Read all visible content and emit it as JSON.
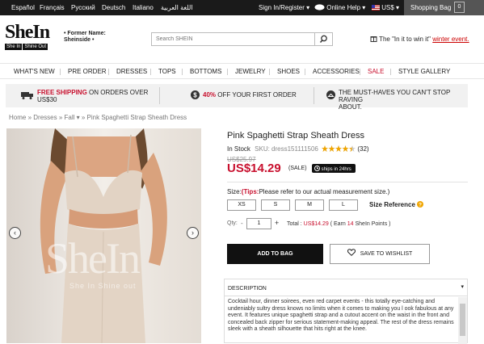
{
  "topbar": {
    "languages": [
      "Español",
      "Français",
      "Русский",
      "Deutsch",
      "Italiano",
      "اللغة العربية"
    ],
    "signin": "Sign In/Register",
    "online_help": "Online Help",
    "currency": "US$",
    "bag": "Shopping Bag",
    "bag_count": "0"
  },
  "header": {
    "logo": "SheIn",
    "logo_tag1": "She In",
    "logo_tag2": "Shine Out",
    "former_line1": "• Former Name:",
    "former_line2": "Sheinside •",
    "search_placeholder": "Search SHEIN",
    "promo_text": "The \"In it to win it\"",
    "promo_link": "winter event."
  },
  "nav": [
    "WHAT'S NEW",
    "PRE ORDER",
    "DRESSES",
    "TOPS",
    "BOTTOMS",
    "JEWELRY",
    "SHOES",
    "ACCESSORIES",
    "SALE",
    "STYLE GALLERY"
  ],
  "infobar": {
    "shipping_strong": "FREE SHIPPING",
    "shipping_rest": "ON ORDERS OVER",
    "shipping_amount": "US$30",
    "discount_pct": "40%",
    "discount_rest": "OFF YOUR FIRST ORDER",
    "musthave_line1": "THE MUST-HAVES YOU CAN'T STOP RAVING",
    "musthave_line2": "ABOUT."
  },
  "breadcrumb": {
    "home": "Home »",
    "dresses": "Dresses »",
    "fall": "Fall",
    "current": "» Pink Spaghetti Strap Sheath Dress"
  },
  "product": {
    "title": "Pink Spaghetti Strap Sheath Dress",
    "stock": "In Stock",
    "sku": "SKU: dress151111506",
    "rating": 4.5,
    "reviews": "(32)",
    "old_price": "US$25.97",
    "price": "US$14.29",
    "sale_label": "(SALE)",
    "ships": "ships in 24hrs",
    "size_label": "Size:",
    "size_tips": "(Tips:",
    "size_tips_rest": "Please refer to our actual measurement size.)",
    "sizes": [
      "XS",
      "S",
      "M",
      "L"
    ],
    "size_reference": "Size Reference",
    "qty_label": "Qty:",
    "qty_value": "1",
    "total_label": "Total :",
    "total_value": "US$14.29",
    "earn_text": "( Earn",
    "earn_points": "14",
    "earn_rest": "SheIn Points )",
    "add_to_bag": "ADD TO BAG",
    "save_wishlist": "SAVE TO WISHLIST",
    "watermark": "SheIn",
    "watermark_sub": "She In   Shine out"
  },
  "description": {
    "heading": "DESCRIPTION",
    "text": "Cocktail hour, dinner soirees, even red carpet events - this totally eye-catching and undeniably sultry dress knows no limits when it comes to making you l ook fabulous at any event. It features unique spaghetti strap and a cutout accent on the waist in the front and concealed back zipper for serious statement-making appeal. The rest of the dress remains sleek with a sheath silhouette that hits right at the knee."
  },
  "colors": {
    "accent_red": "#c8102e",
    "topbar": "#1a1a1a",
    "star": "#f0a500"
  }
}
